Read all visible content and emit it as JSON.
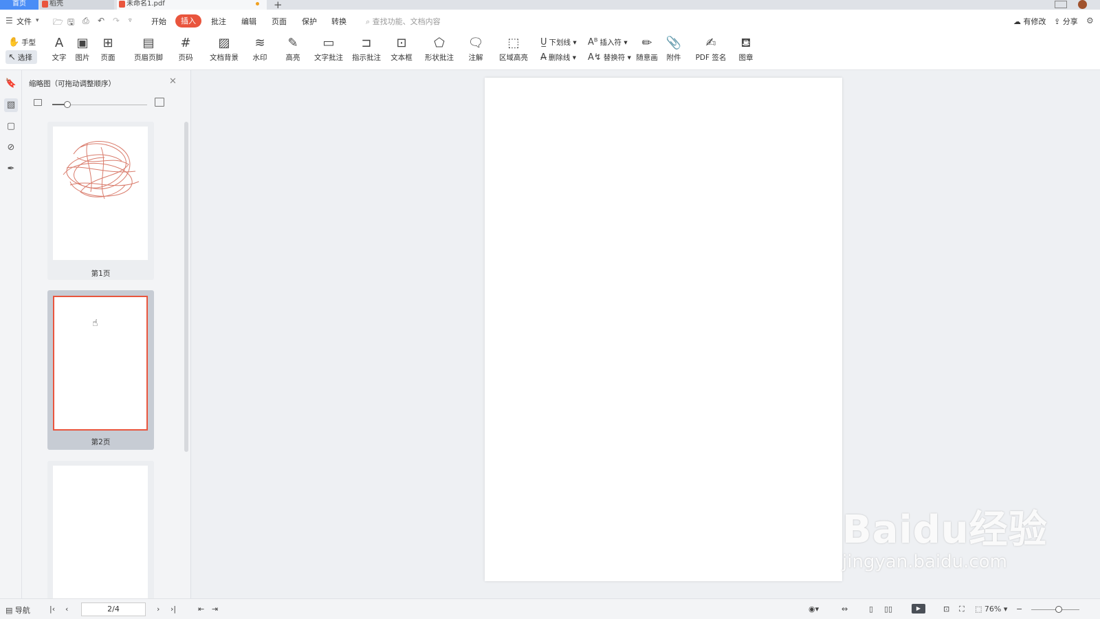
{
  "tabs": {
    "home": "首页",
    "doc1": "稻壳",
    "doc2": "未命名1.pdf",
    "add": "+"
  },
  "menu": {
    "file": "文件",
    "items": [
      "开始",
      "插入",
      "批注",
      "编辑",
      "页面",
      "保护",
      "转换"
    ],
    "active": "插入",
    "search_placeholder": "查找功能、文档内容",
    "has_changes": "有修改",
    "share": "分享"
  },
  "ribbon": {
    "hand": "手型",
    "select": "选择",
    "text": "文字",
    "image": "图片",
    "page": "页面",
    "header_footer": "页眉页脚",
    "page_number": "页码",
    "doc_background": "文档背景",
    "watermark": "水印",
    "highlight": "高亮",
    "text_annotation": "文字批注",
    "pointer_annotation": "指示批注",
    "textbox": "文本框",
    "shape_annotation": "形状批注",
    "note": "注解",
    "area_highlight": "区域高亮",
    "underline": "下划线",
    "strikethrough": "删除线",
    "insert_mark": "插入符",
    "replace_mark": "替换符",
    "freehand": "随意画",
    "attachment": "附件",
    "pdf_sign": "PDF 签名",
    "stamp": "图章"
  },
  "thumbnail_panel": {
    "title": "缩略图（可拖动调整顺序）",
    "size_slider_level": 0.17,
    "pages": [
      {
        "caption": "第1页",
        "selected": false
      },
      {
        "caption": "第2页",
        "selected": true
      },
      {
        "caption": "",
        "selected": false
      }
    ]
  },
  "statusbar": {
    "nav": "导航",
    "page_indicator": "2/4",
    "zoom": "76%"
  },
  "watermark": {
    "logo": "Baidu经验",
    "url": "jingyan.baidu.com"
  },
  "colors": {
    "accent": "#e9553d",
    "home_tab": "#4a8df6",
    "scribble": "#d97a6a"
  }
}
